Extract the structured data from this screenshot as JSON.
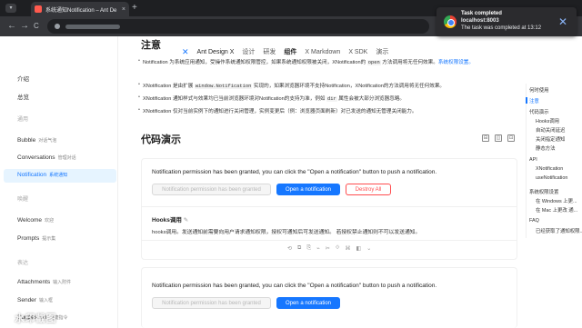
{
  "browser": {
    "tab_title": "系统通知Notification – Ant De",
    "tab_close": "×",
    "new_tab": "+",
    "tab_list": "▾",
    "nav_back": "←",
    "nav_forward": "→",
    "nav_reload": "C"
  },
  "toast": {
    "title": "Task completed",
    "host": "localhost:8003",
    "body": "The task was completed at 13:12",
    "close": "✕"
  },
  "site_nav": {
    "brand": "Ant Design X",
    "items": [
      "设计",
      "研发",
      "组件",
      "X Markdown",
      "X SDK",
      "演示"
    ],
    "active_index": 2
  },
  "sidebar": {
    "items": [
      {
        "label": "介绍",
        "sub": ""
      },
      {
        "label": "总览",
        "sub": ""
      },
      {
        "group": "通用"
      },
      {
        "label": "Bubble",
        "sub": "对话气泡"
      },
      {
        "label": "Conversations",
        "sub": "管理对话"
      },
      {
        "label": "Notification",
        "sub": "系统通知",
        "active": true
      },
      {
        "group": "唤醒"
      },
      {
        "label": "Welcome",
        "sub": "欢迎"
      },
      {
        "label": "Prompts",
        "sub": "提示集"
      },
      {
        "group": "表达"
      },
      {
        "label": "Attachments",
        "sub": "输入附件"
      },
      {
        "label": "Sender",
        "sub": "输入框"
      },
      {
        "label": "Suggestion",
        "sub": "快捷指令"
      }
    ]
  },
  "content": {
    "heading": "注意",
    "bullets": [
      {
        "pre": "Notification 为系统应用通知，受操作系统通知权限管控，如果系统通知权限被关闭，XNotification的 ",
        "code": "open",
        "post": " 方法调用将无任何效果。",
        "link": "系统权限设置。"
      },
      {
        "pre": "XNotification 是由扩展 ",
        "code": "window.Notification",
        "post": " 实现的，如果浏览器环境不支持Notification，XNotification的方法调用将无任何效果。",
        "link": ""
      },
      {
        "pre": "XNotification 通知样式与效果均已当前浏览器环境对Notification的支持为准，例如 ",
        "code": "dir",
        "post": " 属性会被大部分浏览器忽略。",
        "link": ""
      },
      {
        "pre": "XNotification 仅对当前实例下的通知进行关闭管理，实例变更后（例：浏览器页面刷新）对已发送的通知无管理关闭能力。",
        "code": "",
        "post": "",
        "link": ""
      }
    ],
    "demo_heading": "代码演示",
    "demo_tools": [
      "⊟",
      "◫",
      "⊡"
    ],
    "demo1": {
      "text": "Notification permission has been granted, you can click the \"Open a notification\" button to push a notification.",
      "btn_granted": "Notification permission has been granted",
      "btn_open": "Open a notification",
      "btn_destroy": "Destroy All",
      "title": "Hooks调用",
      "edit_icon": "✎",
      "desc": "hooks调用。发送通知前需要向用户请求通知权限，授权可通知后可发送通知。 若授权禁止通知则不可以发送通知。",
      "code_actions": [
        "⟲",
        "⧉",
        "⎘",
        "⌁",
        "✂",
        "⟐",
        "⌘",
        "◧",
        "⌄"
      ]
    },
    "demo2": {
      "text": "Notification permission has been granted, you can click the \"Open a notification\" button to push a notification.",
      "btn_granted": "Notification permission has been granted",
      "btn_open": "Open a notification"
    }
  },
  "toc": {
    "items": [
      {
        "label": "何时使用"
      },
      {
        "label": "注意",
        "active": true
      },
      {
        "label": "代码演示"
      },
      {
        "label": "Hooks调用",
        "indent": true
      },
      {
        "label": "自动关闭延迟",
        "indent": true
      },
      {
        "label": "关闭指定通知",
        "indent": true
      },
      {
        "label": "静态方法",
        "indent": true
      },
      {
        "label": "API"
      },
      {
        "label": "XNotification",
        "indent": true
      },
      {
        "label": "useNotification",
        "indent": true
      },
      {
        "label": "系统权限设置"
      },
      {
        "label": "在 Windows 上更...",
        "indent": true
      },
      {
        "label": "在 Mac 上更改 通...",
        "indent": true
      },
      {
        "label": "FAQ"
      },
      {
        "label": "已经获取了通知权限...",
        "indent": true
      }
    ]
  },
  "watermark": "水印截图",
  "colors": {
    "accent": "#1677ff",
    "danger": "#ff4d4f",
    "active_bg": "#e6f4ff"
  }
}
